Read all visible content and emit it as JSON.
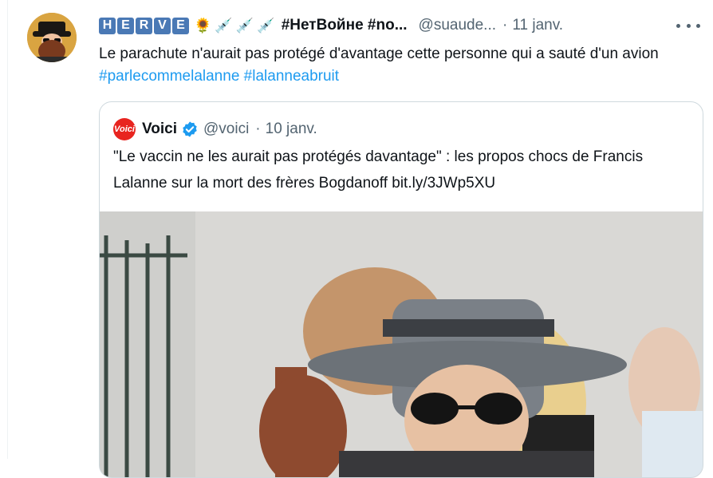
{
  "tweet": {
    "author": {
      "name_letters": [
        "H",
        "E",
        "R",
        "V",
        "E"
      ],
      "name_emoji": [
        "🌻",
        "💉",
        "💉",
        "💉"
      ],
      "tags_text": "#НетВойне #no...",
      "handle": "@suaude...",
      "separator": "·",
      "date": "11 janv."
    },
    "text": {
      "body": "Le parachute n'aurait pas protégé d'avantage cette personne qui a sauté d'un avion ",
      "hashtags": [
        "#parlecommelalanne",
        "#lalanneabruit"
      ]
    },
    "more_icon": "more-horizontal-icon"
  },
  "quoted": {
    "logo_text": "Voici",
    "name": "Voici",
    "verified_icon": "verified-badge-icon",
    "handle": "@voici",
    "separator": "·",
    "date": "10 janv.",
    "text": "\"Le vaccin ne les aurait pas protégés davantage\" : les propos chocs de Francis Lalanne sur la mort des frères Bogdanoff bit.ly/3JWp5XU",
    "image": "photo-man-hat-sunglasses-crowd"
  },
  "colors": {
    "link": "#1d9bf0",
    "secondary_text": "#536471",
    "primary_text": "#0f1419",
    "border": "#cfd9de",
    "voici_red": "#e8241f"
  }
}
